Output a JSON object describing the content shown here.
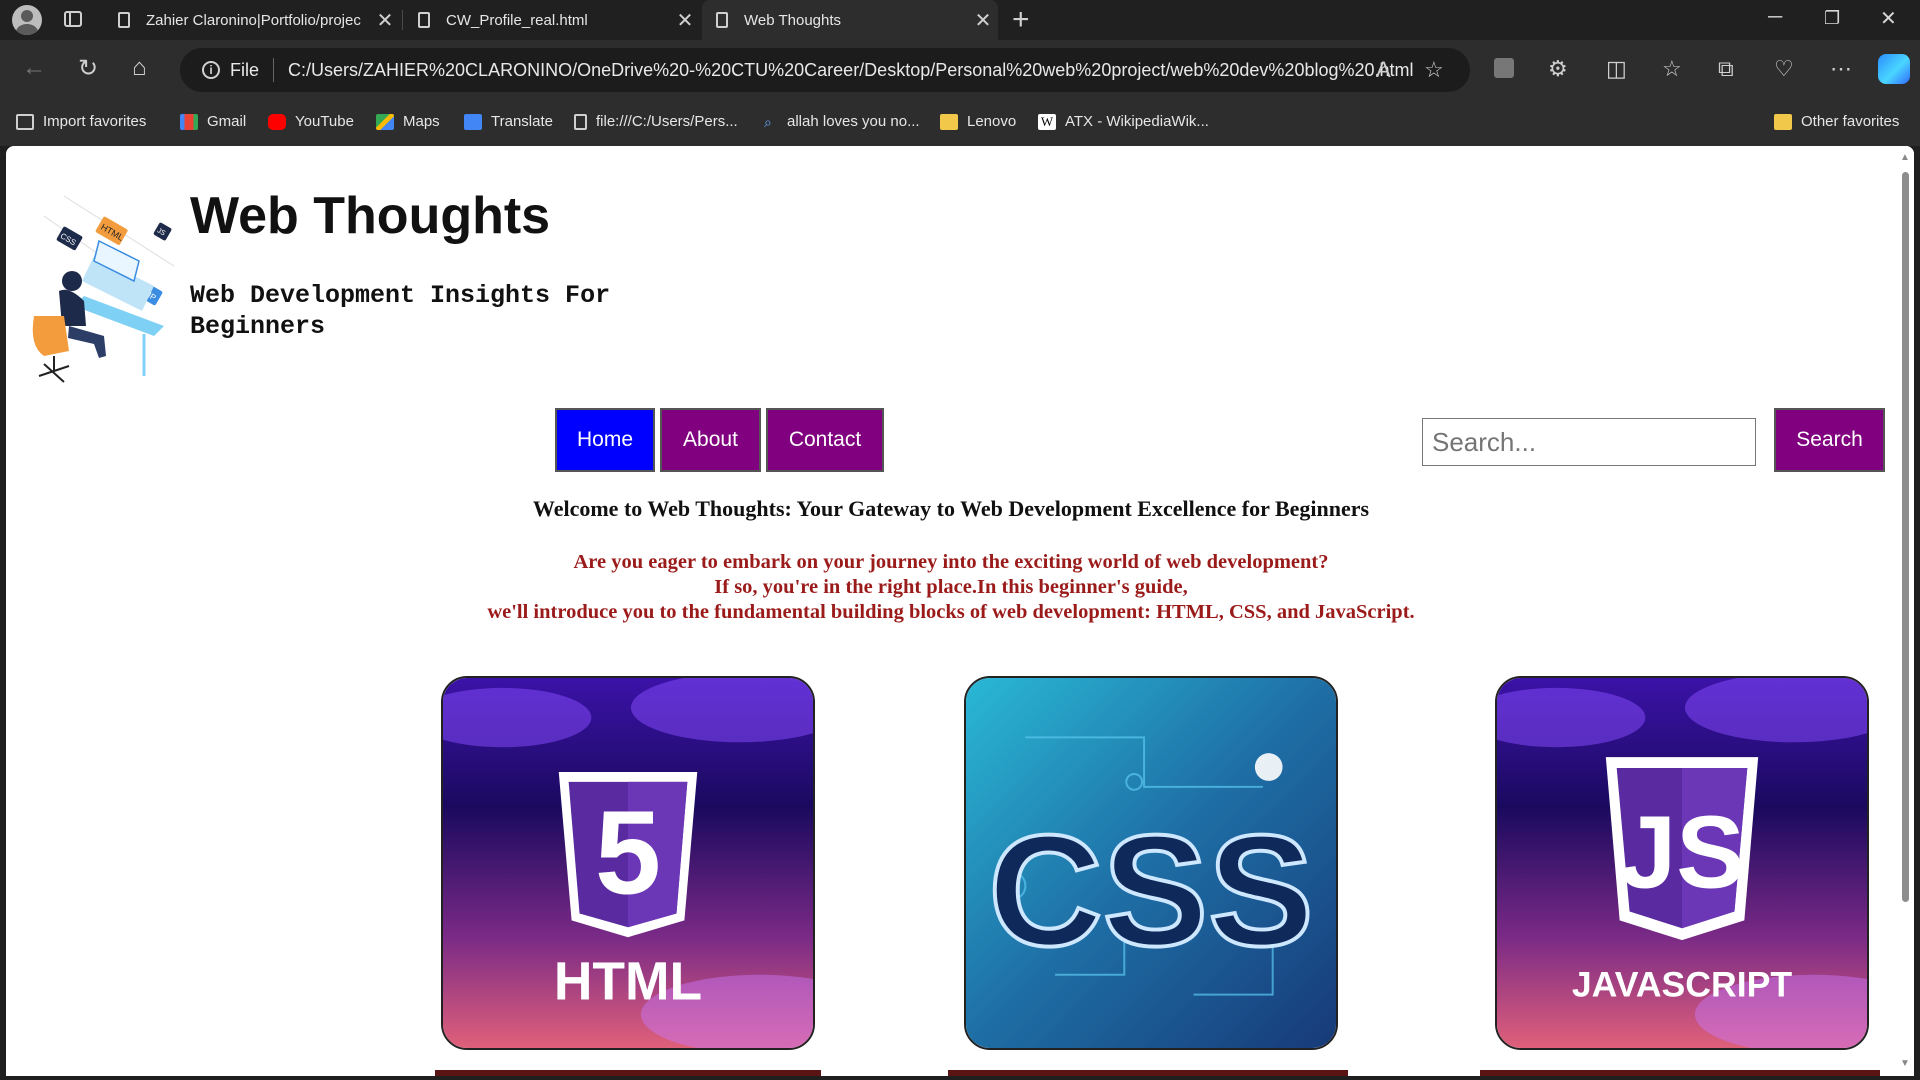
{
  "browser": {
    "tabs": [
      {
        "title": "Zahier Claronino|Portfolio/projec",
        "active": false
      },
      {
        "title": "CW_Profile_real.html",
        "active": false
      },
      {
        "title": "Web Thoughts",
        "active": true
      }
    ],
    "address": {
      "scheme_label": "File",
      "url": "C:/Users/ZAHIER%20CLARONINO/OneDrive%20-%20CTU%20Career/Desktop/Personal%20web%20project/web%20dev%20blog%20.html"
    },
    "favorites": [
      {
        "label": "Import favorites",
        "icon": "import-icon"
      },
      {
        "label": "Gmail",
        "icon": "gmail-icon"
      },
      {
        "label": "YouTube",
        "icon": "youtube-icon"
      },
      {
        "label": "Maps",
        "icon": "maps-icon"
      },
      {
        "label": "Translate",
        "icon": "translate-icon"
      },
      {
        "label": "file:///C:/Users/Pers...",
        "icon": "file-icon"
      },
      {
        "label": "allah loves you no...",
        "icon": "search-icon"
      },
      {
        "label": "Lenovo",
        "icon": "folder-icon"
      },
      {
        "label": "ATX - WikipediaWik...",
        "icon": "wikipedia-icon"
      }
    ],
    "other_favorites": "Other favorites"
  },
  "page": {
    "title": "Web Thoughts",
    "subtitle": "Web Development Insights For Beginners",
    "nav": {
      "home": "Home",
      "about": "About",
      "contact": "Contact"
    },
    "search": {
      "placeholder": "Search...",
      "button": "Search"
    },
    "welcome": "Welcome to Web Thoughts: Your Gateway to Web Development Excellence for Beginners",
    "intro": [
      "Are you eager to embark on your journey into the exciting world of web development?",
      "If so, you're in the right place.In this beginner's guide,",
      "we'll introduce you to the fundamental building blocks of web development: HTML, CSS, and JavaScript."
    ],
    "cards": [
      {
        "label": "HTML",
        "badge": "5"
      },
      {
        "label": "CSS"
      },
      {
        "label": "JAVASCRIPT",
        "badge": "JS"
      }
    ],
    "logo_tags": [
      "CSS",
      "HTML",
      "JS",
      "PHP"
    ]
  },
  "colors": {
    "purple": "#800080",
    "home_blue": "#0000ff",
    "intro_red": "#9b1a1a"
  }
}
